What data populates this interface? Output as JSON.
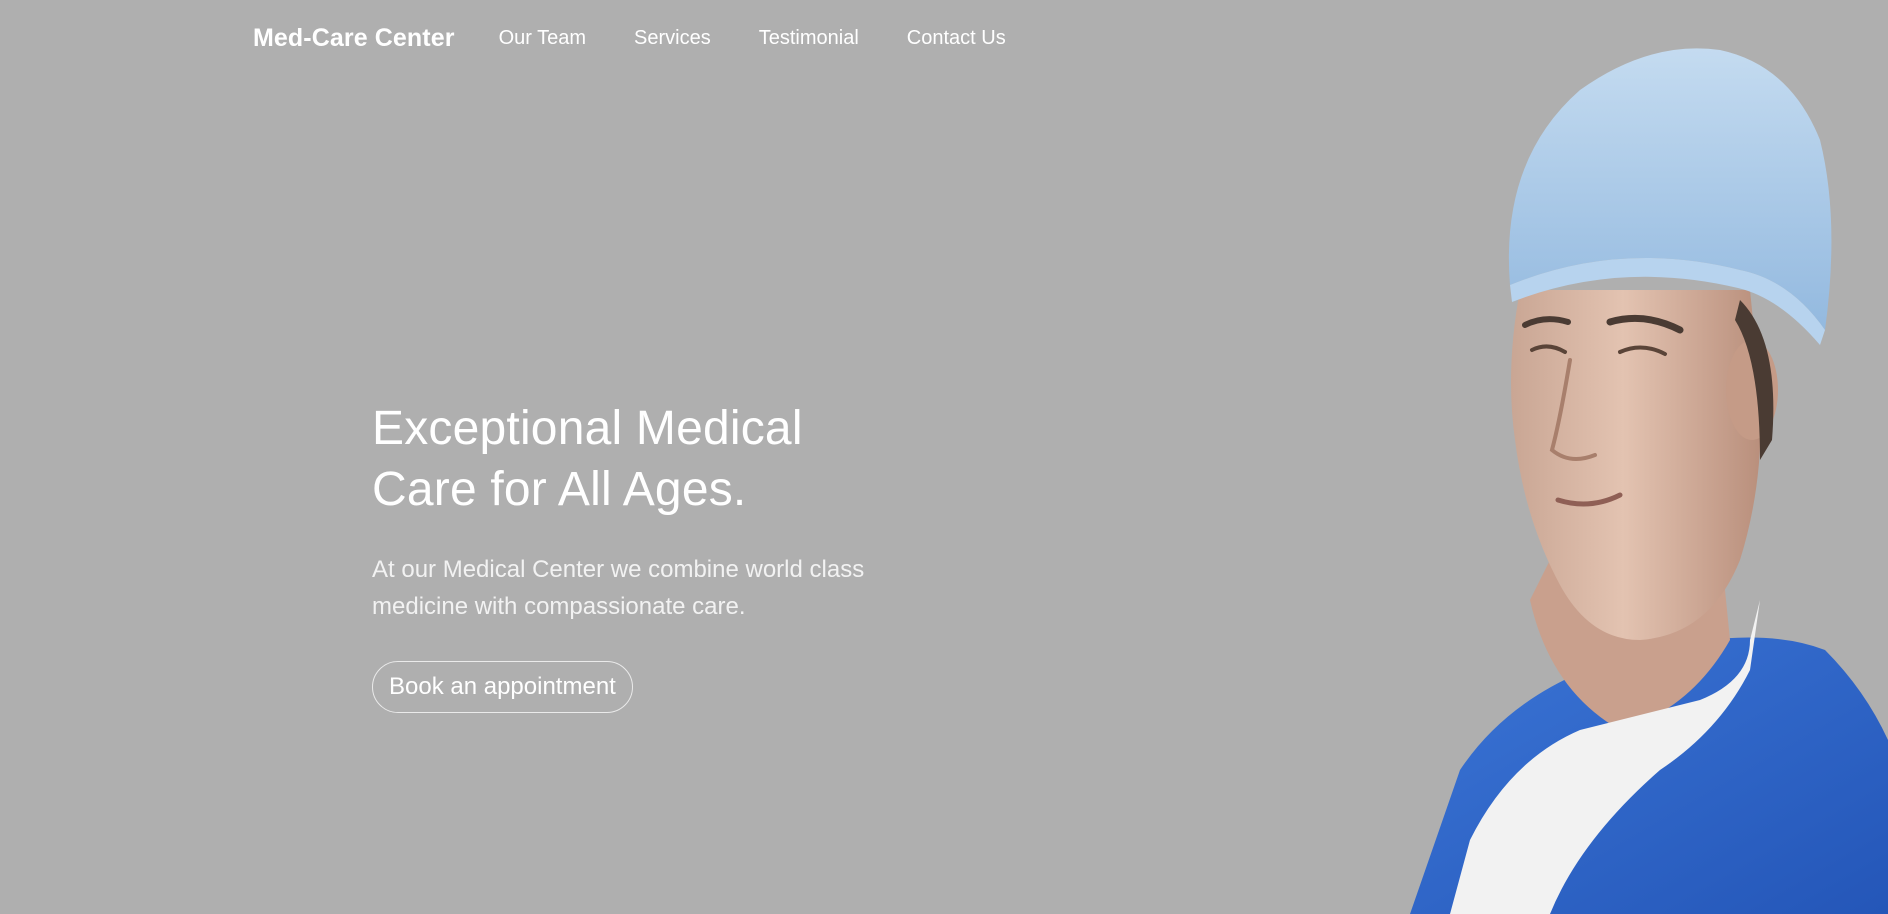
{
  "nav": {
    "brand": "Med-Care Center",
    "links": [
      "Our Team",
      "Services",
      "Testimonial",
      "Contact Us"
    ]
  },
  "hero": {
    "title_line1": "Exceptional Medical",
    "title_line2": "Care for All Ages.",
    "subtitle_line1": "At our Medical Center we combine world class",
    "subtitle_line2": "medicine with compassionate care.",
    "cta_label": "Book an appointment"
  },
  "image": {
    "subject": "doctor-in-surgical-cap-and-scrubs"
  },
  "colors": {
    "background": "#afafaf",
    "text": "#ffffff",
    "scrubs": "#2f66c9",
    "cap": "#a9c8e6",
    "skin": "#d9b7a3"
  }
}
